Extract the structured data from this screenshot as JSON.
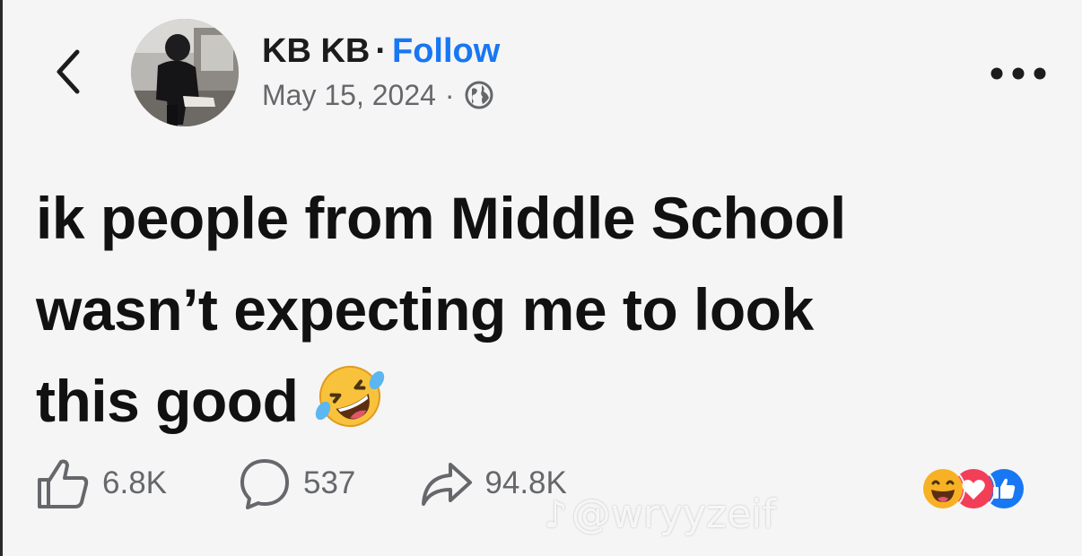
{
  "header": {
    "author_name": "KB KB",
    "separator": "·",
    "follow_label": "Follow",
    "date": "May 15, 2024",
    "meta_separator": "·",
    "icons": {
      "back": "chevron-left-icon",
      "privacy": "globe-icon",
      "more": "more-horizontal-icon"
    }
  },
  "post": {
    "lines": [
      "ik people from Middle School",
      "wasn’t expecting me to look",
      "this good"
    ],
    "emoji": "rolling-on-floor-laughing-emoji"
  },
  "actions": {
    "like_count": "6.8K",
    "comment_count": "537",
    "share_count": "94.8K"
  },
  "reactions": [
    "haha",
    "love",
    "like"
  ],
  "watermark": {
    "logo": "tiktok",
    "handle": "@wryyzeif"
  },
  "colors": {
    "background": "#f5f5f6",
    "follow": "#1877f2",
    "muted": "#65676b",
    "like_blue": "#1877f2",
    "love_red": "#f33e58",
    "haha_yellow": "#f7b125"
  }
}
